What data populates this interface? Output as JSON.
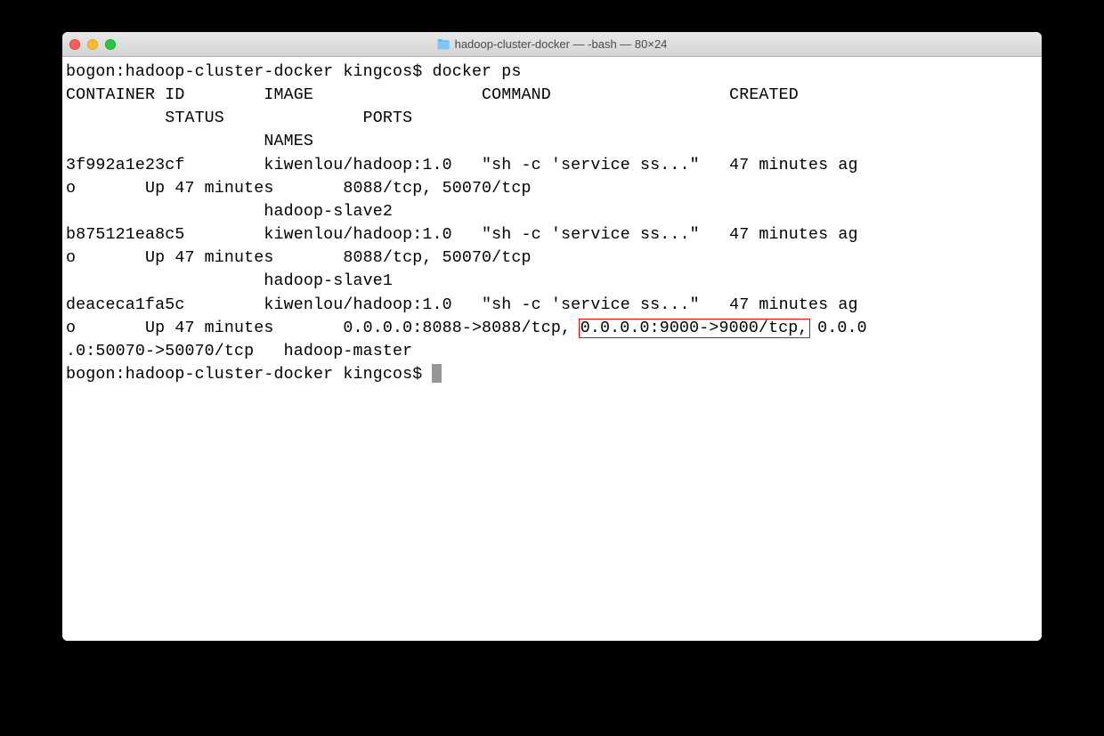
{
  "window": {
    "title": "hadoop-cluster-docker — -bash — 80×24"
  },
  "terminal": {
    "line1": "bogon:hadoop-cluster-docker kingcos$ docker ps",
    "line2": "CONTAINER ID        IMAGE                 COMMAND                  CREATED    ",
    "line3": "          STATUS              PORTS                                            ",
    "line4": "                    NAMES",
    "line5": "3f992a1e23cf        kiwenlou/hadoop:1.0   \"sh -c 'service ss...\"   47 minutes ag",
    "line6": "o       Up 47 minutes       8088/tcp, 50070/tcp                              ",
    "line7": "                    hadoop-slave2",
    "line8": "b875121ea8c5        kiwenlou/hadoop:1.0   \"sh -c 'service ss...\"   47 minutes ag",
    "line9": "o       Up 47 minutes       8088/tcp, 50070/tcp                              ",
    "line10": "                    hadoop-slave1",
    "line11": "deaceca1fa5c        kiwenlou/hadoop:1.0   \"sh -c 'service ss...\"   47 minutes ag",
    "line12a": "o       Up 47 minutes       0.0.0.0:8088->8088/tcp, ",
    "line12b": "0.0.0.0:9000->9000/tcp,",
    "line12c": " 0.0.0",
    "line13": ".0:50070->50070/tcp   hadoop-master",
    "line14": "bogon:hadoop-cluster-docker kingcos$ "
  }
}
